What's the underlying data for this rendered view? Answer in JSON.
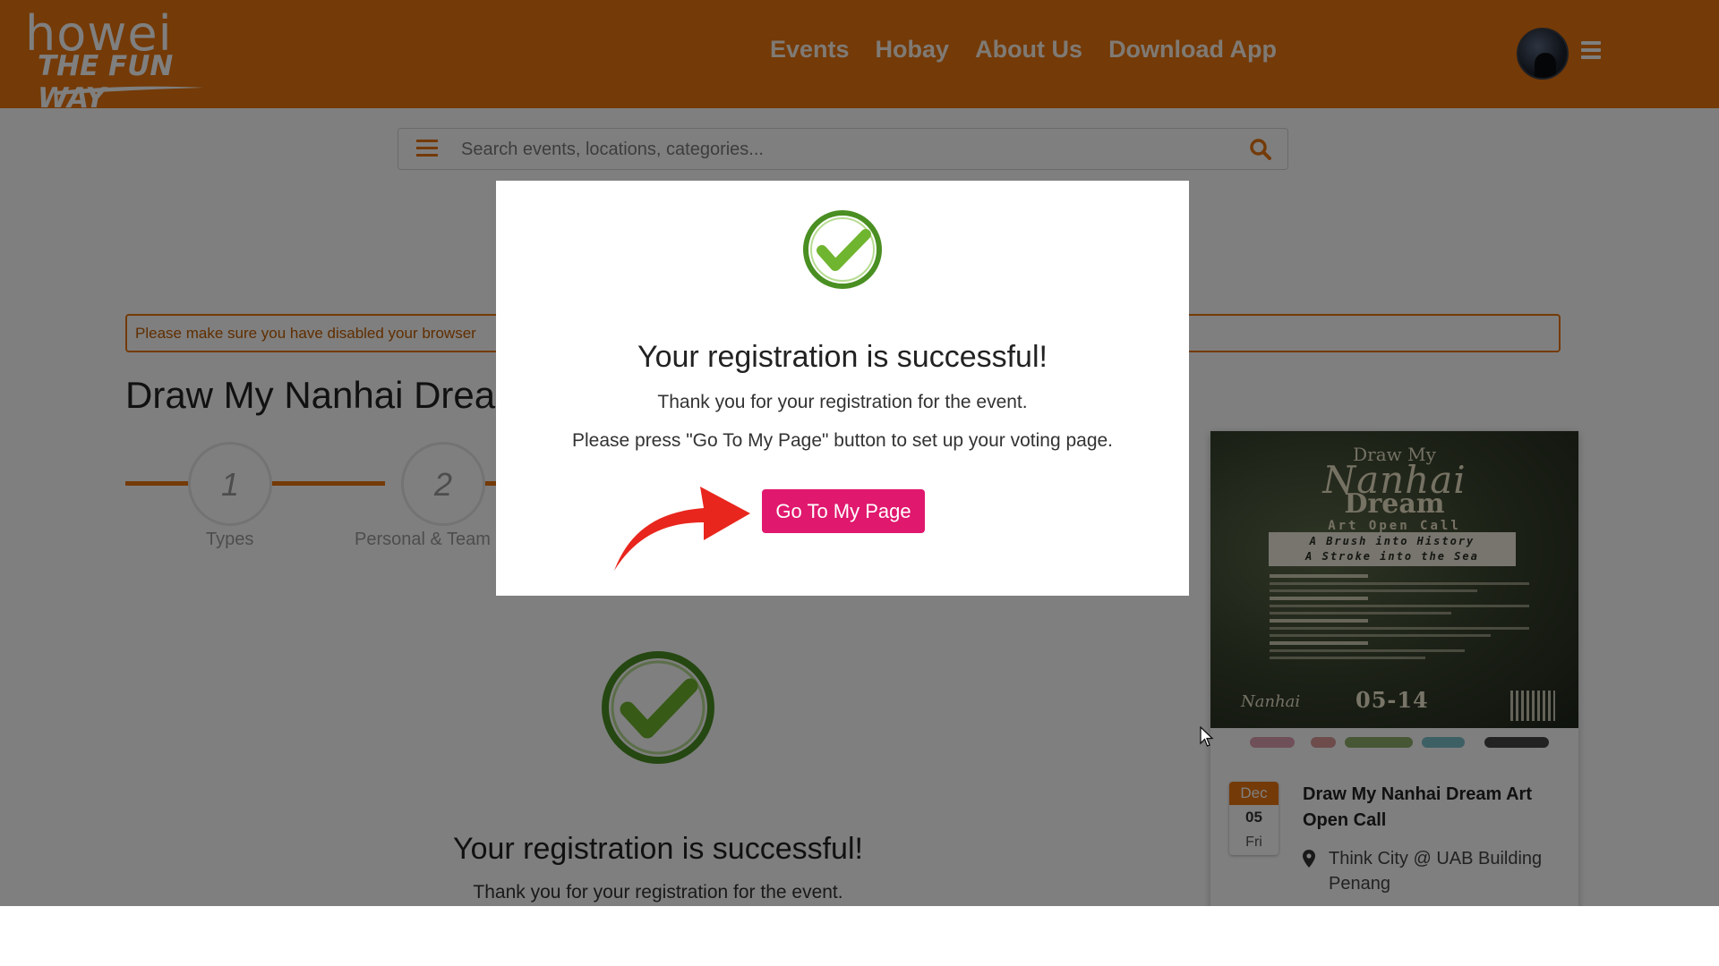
{
  "header": {
    "logo_word": "howei",
    "logo_tagline": "THE FUN WAY",
    "nav": [
      "Events",
      "Hobay",
      "About Us",
      "Download App"
    ]
  },
  "search": {
    "placeholder": "Search events, locations, categories..."
  },
  "notice": {
    "text": "Please make sure you have disabled your browser"
  },
  "event_title": "Draw My Nanhai Drea",
  "stepper": {
    "steps": [
      {
        "number": "1",
        "label": "Types"
      },
      {
        "number": "2",
        "label": "Personal & Team"
      }
    ]
  },
  "background_success": {
    "title": "Your registration is successful!",
    "subtitle": "Thank you for your registration for the event."
  },
  "card": {
    "poster": {
      "line1": "Draw My",
      "line2": "Nanhai",
      "line3": "Dream",
      "art_open_call": "Art Open Call",
      "banner_line1": "A Brush into History",
      "banner_line2": "A Stroke into the Sea",
      "date": "05-14",
      "mini_logo": "Nanhai"
    },
    "month": "Dec",
    "day": "05",
    "weekday": "Fri",
    "title": "Draw My Nanhai Dream Art Open Call",
    "location": "Think City @ UAB Building Penang"
  },
  "modal": {
    "title": "Your registration is successful!",
    "subtitle": "Thank you for your registration for the event.",
    "instruction": "Please press \"Go To My Page\" button to set up your voting page.",
    "button_label": "Go To My Page"
  },
  "colors": {
    "brand_orange": "#e8750f",
    "button_pink": "#e0186e",
    "check_green": "#5aa72e",
    "arrow_red": "#e8261d"
  }
}
